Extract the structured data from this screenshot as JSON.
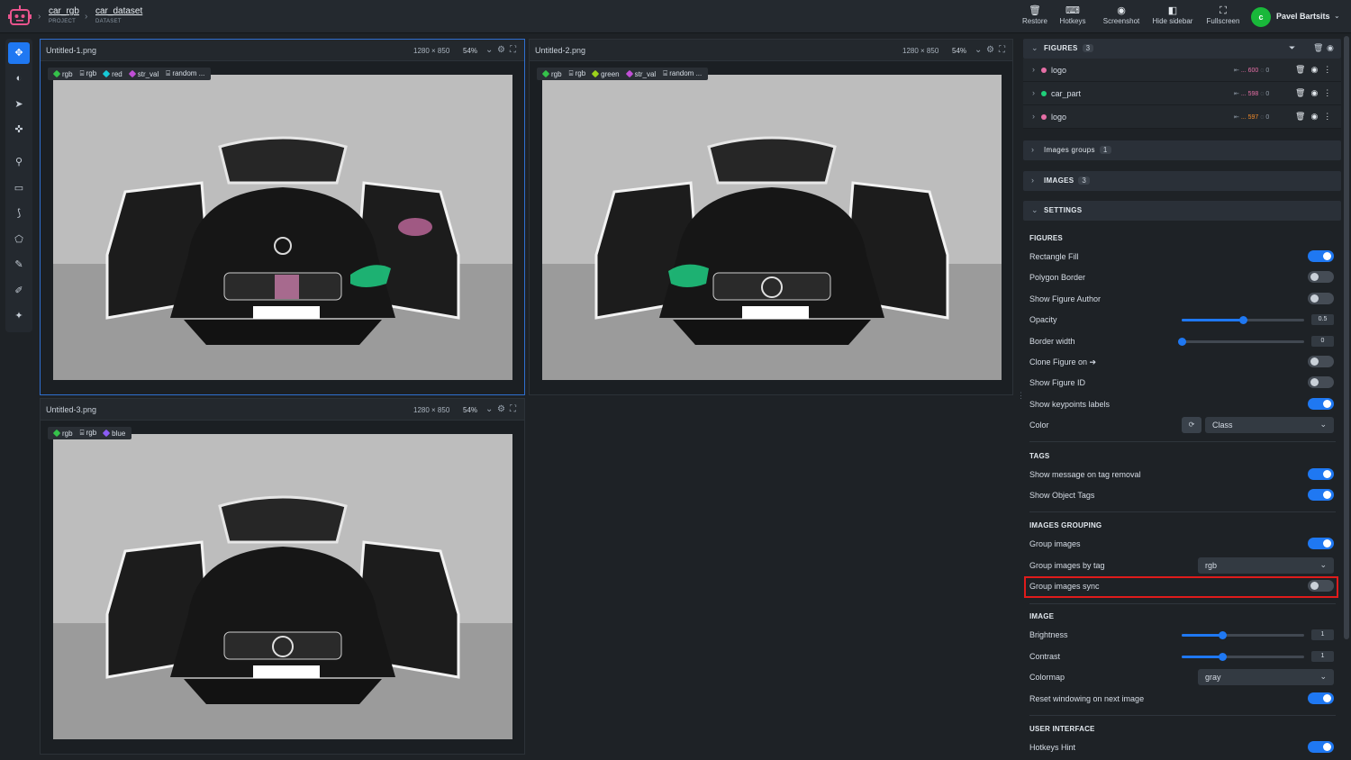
{
  "breadcrumb": [
    {
      "title": "car_rgb",
      "sub": "PROJECT"
    },
    {
      "title": "car_dataset",
      "sub": "DATASET"
    }
  ],
  "top_buttons": [
    {
      "label": "Restore",
      "icon": "trash-icon"
    },
    {
      "label": "Hotkeys",
      "icon": "keyboard-icon"
    },
    {
      "label": "Screenshot",
      "icon": "camera-icon"
    },
    {
      "label": "Hide sidebar",
      "icon": "sidebar-icon"
    },
    {
      "label": "Fullscreen",
      "icon": "fullscreen-icon"
    }
  ],
  "user": {
    "initial": "c",
    "name": "Pavel Bartsits"
  },
  "panels": [
    {
      "file": "Untitled-1.png",
      "dims": "1280 × 850",
      "zoom": "54%",
      "tags": [
        {
          "label": "rgb",
          "color": "#35c24a",
          "icon": "tag"
        },
        {
          "label": "rgb",
          "icon": "text"
        },
        {
          "label": "red",
          "color": "#17c9d6",
          "icon": "tag"
        },
        {
          "label": "str_val",
          "color": "#c04fd6",
          "icon": "tag"
        },
        {
          "label": "random ...",
          "icon": "text"
        }
      ]
    },
    {
      "file": "Untitled-2.png",
      "dims": "1280 × 850",
      "zoom": "54%",
      "tags": [
        {
          "label": "rgb",
          "color": "#35c24a",
          "icon": "tag"
        },
        {
          "label": "rgb",
          "icon": "text"
        },
        {
          "label": "green",
          "color": "#9cd21b",
          "icon": "tag"
        },
        {
          "label": "str_val",
          "color": "#c04fd6",
          "icon": "tag"
        },
        {
          "label": "random ...",
          "icon": "text"
        }
      ]
    },
    {
      "file": "Untitled-3.png",
      "dims": "1280 × 850",
      "zoom": "54%",
      "tags": [
        {
          "label": "rgb",
          "color": "#35c24a",
          "icon": "tag"
        },
        {
          "label": "rgb",
          "icon": "text"
        },
        {
          "label": "blue",
          "color": "#8b5cf6",
          "icon": "tag"
        }
      ]
    }
  ],
  "figures": {
    "title": "FIGURES",
    "count": "3",
    "items": [
      {
        "name": "logo",
        "color": "#e66fa6",
        "id": "... 600",
        "idcolor": "#e66fa6",
        "tags": "0"
      },
      {
        "name": "car_part",
        "color": "#1fd07a",
        "id": "... 598",
        "idcolor": "#e66fa6",
        "tags": "0"
      },
      {
        "name": "logo",
        "color": "#e66fa6",
        "id": "... 597",
        "idcolor": "#f08a2a",
        "tags": "0"
      }
    ]
  },
  "images_groups": {
    "title": "Images groups",
    "count": "1"
  },
  "images": {
    "title": "IMAGES",
    "count": "3"
  },
  "settings": {
    "title": "SETTINGS",
    "figures_head": "FIGURES",
    "rectangle_fill": "Rectangle Fill",
    "polygon_border": "Polygon Border",
    "show_figure_author": "Show Figure Author",
    "opacity": "Opacity",
    "opacity_val": "0.5",
    "opacity_level": 0.5,
    "border_width": "Border width",
    "border_val": "0",
    "border_level": 0,
    "clone_figure": "Clone Figure on ➔",
    "show_figure_id": "Show Figure ID",
    "show_kp_labels": "Show keypoints labels",
    "color": "Color",
    "color_select": "Class",
    "tags_head": "TAGS",
    "msg_tag_removal": "Show message on tag removal",
    "show_object_tags": "Show Object Tags",
    "grouping_head": "IMAGES GROUPING",
    "group_images": "Group images",
    "group_by_tag": "Group images by tag",
    "group_by_tag_val": "rgb",
    "group_sync": "Group images sync",
    "image_head": "IMAGE",
    "brightness": "Brightness",
    "brightness_val": "1",
    "brightness_level": 0.33,
    "contrast": "Contrast",
    "contrast_val": "1",
    "contrast_level": 0.33,
    "colormap": "Colormap",
    "colormap_val": "gray",
    "reset_window": "Reset windowing on next image",
    "ui_head": "USER INTERFACE",
    "hotkeys_hint": "Hotkeys Hint"
  }
}
